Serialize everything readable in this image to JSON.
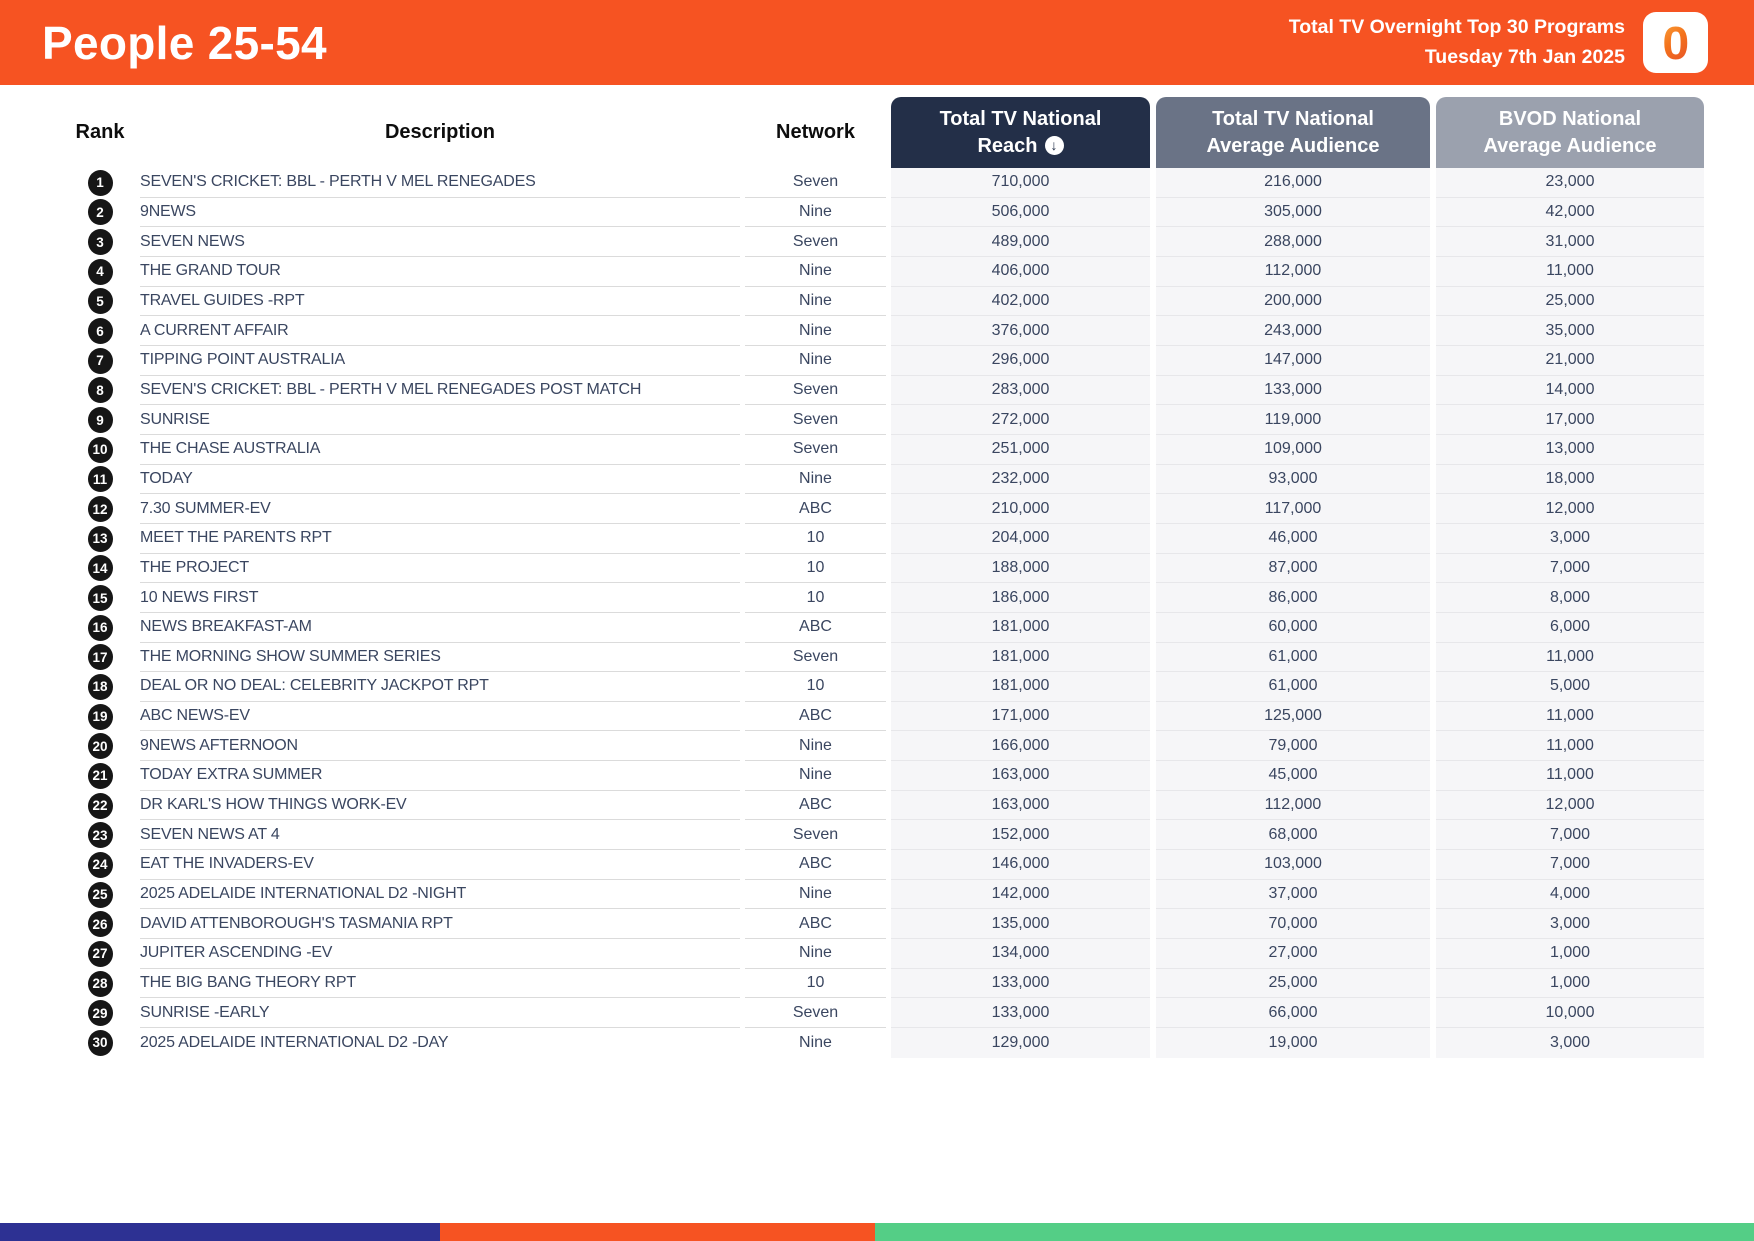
{
  "header": {
    "title": "People 25-54",
    "subtitle_line1": "Total TV Overnight Top 30 Programs",
    "subtitle_line2": "Tuesday 7th Jan 2025",
    "logo_char": "0"
  },
  "icons": {
    "sort_descending": "↓"
  },
  "colors": {
    "header_bg": "#F65322",
    "reach_box": "#232F48",
    "avg_box": "#6A7386",
    "bvod_box": "#9BA1AE",
    "row_band": "#F6F6F8",
    "cell_text": "#3A4660",
    "rank_badge": "#161616"
  },
  "table": {
    "headers": {
      "rank": "Rank",
      "description": "Description",
      "network": "Network",
      "reach": {
        "line1": "Total TV National",
        "line2": "Reach"
      },
      "avg": {
        "line1": "Total TV National",
        "line2": "Average Audience"
      },
      "bvod": {
        "line1": "BVOD National",
        "line2": "Average Audience"
      }
    },
    "rows": [
      {
        "rank": "1",
        "description": "SEVEN'S CRICKET: BBL - PERTH V MEL RENEGADES",
        "network": "Seven",
        "reach": "710,000",
        "avg": "216,000",
        "bvod": "23,000"
      },
      {
        "rank": "2",
        "description": "9NEWS",
        "network": "Nine",
        "reach": "506,000",
        "avg": "305,000",
        "bvod": "42,000"
      },
      {
        "rank": "3",
        "description": "SEVEN NEWS",
        "network": "Seven",
        "reach": "489,000",
        "avg": "288,000",
        "bvod": "31,000"
      },
      {
        "rank": "4",
        "description": "THE GRAND TOUR",
        "network": "Nine",
        "reach": "406,000",
        "avg": "112,000",
        "bvod": "11,000"
      },
      {
        "rank": "5",
        "description": "TRAVEL GUIDES -RPT",
        "network": "Nine",
        "reach": "402,000",
        "avg": "200,000",
        "bvod": "25,000"
      },
      {
        "rank": "6",
        "description": "A CURRENT AFFAIR",
        "network": "Nine",
        "reach": "376,000",
        "avg": "243,000",
        "bvod": "35,000"
      },
      {
        "rank": "7",
        "description": "TIPPING POINT AUSTRALIA",
        "network": "Nine",
        "reach": "296,000",
        "avg": "147,000",
        "bvod": "21,000"
      },
      {
        "rank": "8",
        "description": "SEVEN'S CRICKET: BBL - PERTH V MEL RENEGADES POST MATCH",
        "network": "Seven",
        "reach": "283,000",
        "avg": "133,000",
        "bvod": "14,000"
      },
      {
        "rank": "9",
        "description": "SUNRISE",
        "network": "Seven",
        "reach": "272,000",
        "avg": "119,000",
        "bvod": "17,000"
      },
      {
        "rank": "10",
        "description": "THE CHASE AUSTRALIA",
        "network": "Seven",
        "reach": "251,000",
        "avg": "109,000",
        "bvod": "13,000"
      },
      {
        "rank": "11",
        "description": "TODAY",
        "network": "Nine",
        "reach": "232,000",
        "avg": "93,000",
        "bvod": "18,000"
      },
      {
        "rank": "12",
        "description": "7.30 SUMMER-EV",
        "network": "ABC",
        "reach": "210,000",
        "avg": "117,000",
        "bvod": "12,000"
      },
      {
        "rank": "13",
        "description": "MEET THE PARENTS RPT",
        "network": "10",
        "reach": "204,000",
        "avg": "46,000",
        "bvod": "3,000"
      },
      {
        "rank": "14",
        "description": "THE PROJECT",
        "network": "10",
        "reach": "188,000",
        "avg": "87,000",
        "bvod": "7,000"
      },
      {
        "rank": "15",
        "description": "10 NEWS FIRST",
        "network": "10",
        "reach": "186,000",
        "avg": "86,000",
        "bvod": "8,000"
      },
      {
        "rank": "16",
        "description": "NEWS BREAKFAST-AM",
        "network": "ABC",
        "reach": "181,000",
        "avg": "60,000",
        "bvod": "6,000"
      },
      {
        "rank": "17",
        "description": "THE MORNING SHOW SUMMER SERIES",
        "network": "Seven",
        "reach": "181,000",
        "avg": "61,000",
        "bvod": "11,000"
      },
      {
        "rank": "18",
        "description": "DEAL OR NO DEAL: CELEBRITY JACKPOT RPT",
        "network": "10",
        "reach": "181,000",
        "avg": "61,000",
        "bvod": "5,000"
      },
      {
        "rank": "19",
        "description": "ABC NEWS-EV",
        "network": "ABC",
        "reach": "171,000",
        "avg": "125,000",
        "bvod": "11,000"
      },
      {
        "rank": "20",
        "description": "9NEWS AFTERNOON",
        "network": "Nine",
        "reach": "166,000",
        "avg": "79,000",
        "bvod": "11,000"
      },
      {
        "rank": "21",
        "description": "TODAY EXTRA SUMMER",
        "network": "Nine",
        "reach": "163,000",
        "avg": "45,000",
        "bvod": "11,000"
      },
      {
        "rank": "22",
        "description": "DR KARL'S HOW THINGS WORK-EV",
        "network": "ABC",
        "reach": "163,000",
        "avg": "112,000",
        "bvod": "12,000"
      },
      {
        "rank": "23",
        "description": "SEVEN NEWS AT 4",
        "network": "Seven",
        "reach": "152,000",
        "avg": "68,000",
        "bvod": "7,000"
      },
      {
        "rank": "24",
        "description": "EAT THE INVADERS-EV",
        "network": "ABC",
        "reach": "146,000",
        "avg": "103,000",
        "bvod": "7,000"
      },
      {
        "rank": "25",
        "description": "2025 ADELAIDE INTERNATIONAL D2 -NIGHT",
        "network": "Nine",
        "reach": "142,000",
        "avg": "37,000",
        "bvod": "4,000"
      },
      {
        "rank": "26",
        "description": "DAVID ATTENBOROUGH'S TASMANIA RPT",
        "network": "ABC",
        "reach": "135,000",
        "avg": "70,000",
        "bvod": "3,000"
      },
      {
        "rank": "27",
        "description": "JUPITER ASCENDING -EV",
        "network": "Nine",
        "reach": "134,000",
        "avg": "27,000",
        "bvod": "1,000"
      },
      {
        "rank": "28",
        "description": "THE BIG BANG THEORY RPT",
        "network": "10",
        "reach": "133,000",
        "avg": "25,000",
        "bvod": "1,000"
      },
      {
        "rank": "29",
        "description": "SUNRISE -EARLY",
        "network": "Seven",
        "reach": "133,000",
        "avg": "66,000",
        "bvod": "10,000"
      },
      {
        "rank": "30",
        "description": "2025 ADELAIDE INTERNATIONAL D2 -DAY",
        "network": "Nine",
        "reach": "129,000",
        "avg": "19,000",
        "bvod": "3,000"
      }
    ]
  },
  "footer": {
    "segments": [
      {
        "color": "#2D3193",
        "width": "25.1%"
      },
      {
        "color": "#F65322",
        "width": "24.8%"
      },
      {
        "color": "#54CE86",
        "width": "50.1%"
      }
    ]
  }
}
